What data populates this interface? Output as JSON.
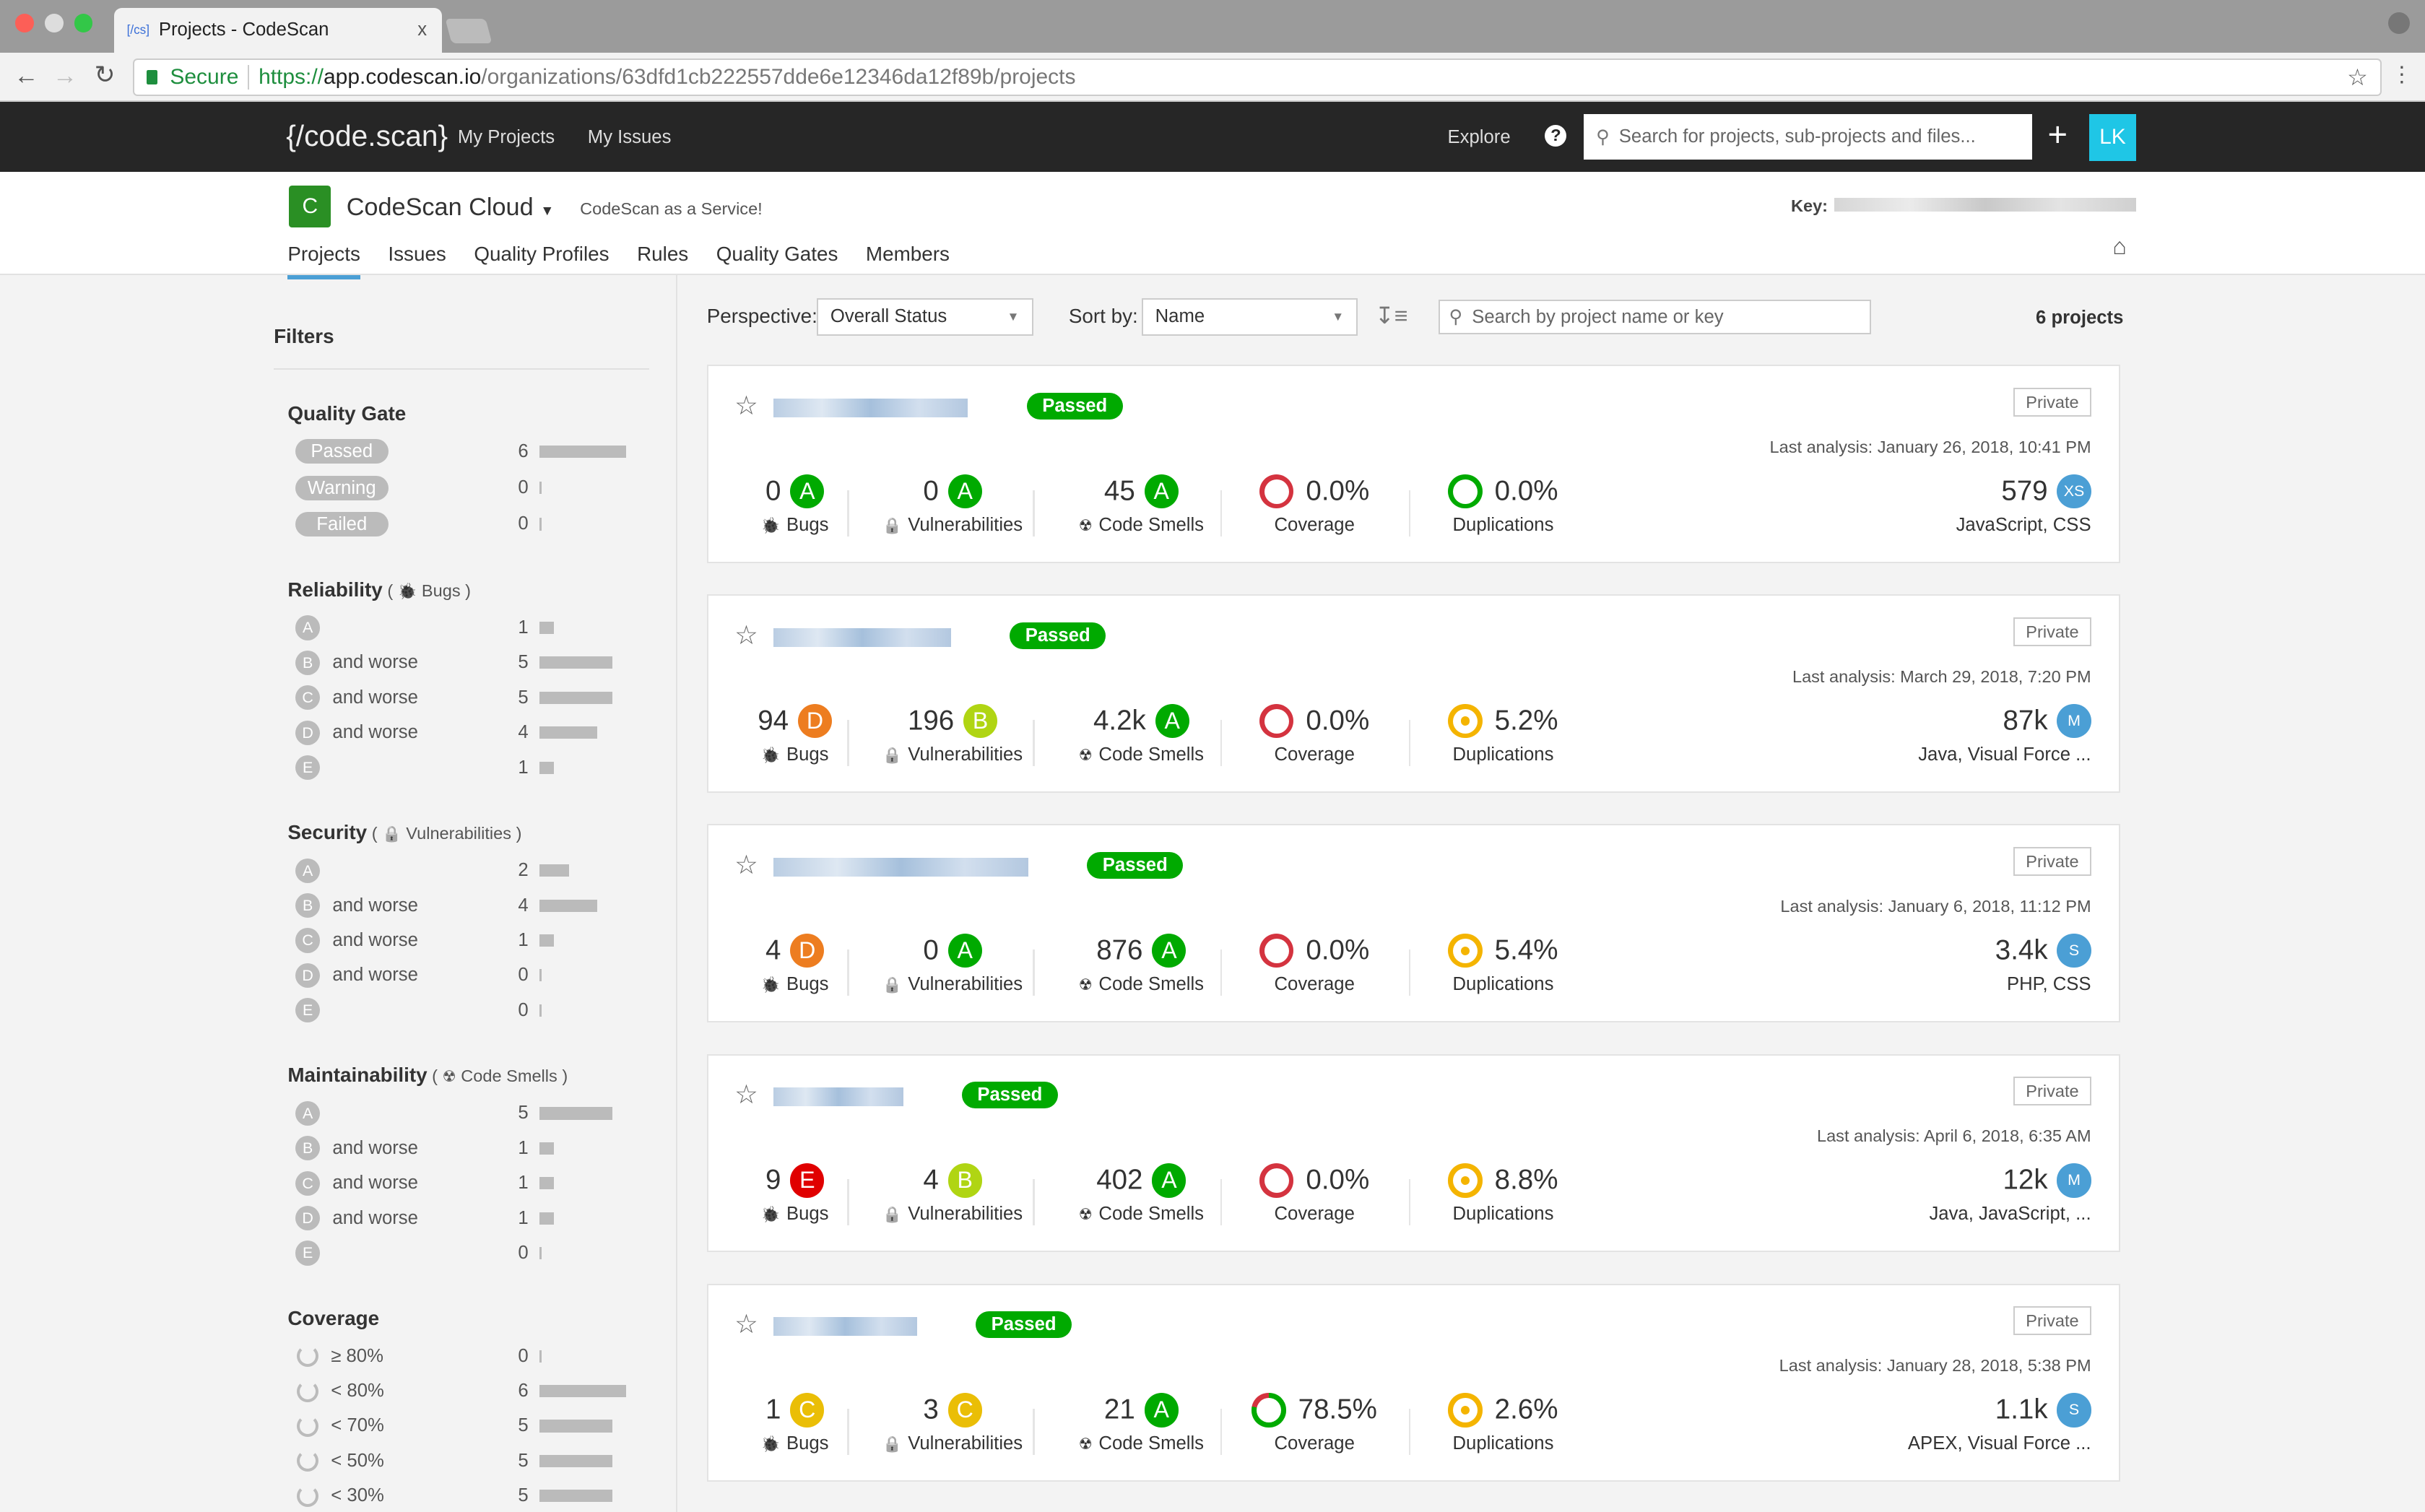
{
  "browser": {
    "tab_favicon": "[/cs]",
    "tab_title": "Projects - CodeScan",
    "tab_close": "x",
    "secure": "Secure",
    "url_proto": "https://",
    "url_host": "app.codescan.io",
    "url_path": "/organizations/63dfd1cb222557dde6e12346da12f89b/projects"
  },
  "nav": {
    "logo": "{/code.scan}",
    "my_projects": "My Projects",
    "my_issues": "My Issues",
    "explore": "Explore",
    "help": "?",
    "search_placeholder": "Search for projects, sub-projects and files...",
    "plus": "+",
    "avatar": "LK"
  },
  "org": {
    "icon_letter": "C",
    "name": "CodeScan Cloud",
    "tagline": "CodeScan as a Service!",
    "key_label": "Key:",
    "menu": [
      "Projects",
      "Issues",
      "Quality Profiles",
      "Rules",
      "Quality Gates",
      "Members"
    ]
  },
  "toolbar": {
    "perspective_label": "Perspective:",
    "perspective_value": "Overall Status",
    "sort_label": "Sort by:",
    "sort_value": "Name",
    "search_placeholder": "Search by project name or key",
    "count": "6 projects"
  },
  "filters": {
    "title": "Filters",
    "quality_gate": {
      "title": "Quality Gate",
      "rows": [
        {
          "label": "Passed",
          "count": 6
        },
        {
          "label": "Warning",
          "count": 0
        },
        {
          "label": "Failed",
          "count": 0
        }
      ]
    },
    "reliability": {
      "title": "Reliability",
      "sub": "Bugs",
      "rows": [
        {
          "r": "A",
          "label": "",
          "count": 1
        },
        {
          "r": "B",
          "label": "and worse",
          "count": 5
        },
        {
          "r": "C",
          "label": "and worse",
          "count": 5
        },
        {
          "r": "D",
          "label": "and worse",
          "count": 4
        },
        {
          "r": "E",
          "label": "",
          "count": 1
        }
      ]
    },
    "security": {
      "title": "Security",
      "sub": "Vulnerabilities",
      "rows": [
        {
          "r": "A",
          "label": "",
          "count": 2
        },
        {
          "r": "B",
          "label": "and worse",
          "count": 4
        },
        {
          "r": "C",
          "label": "and worse",
          "count": 1
        },
        {
          "r": "D",
          "label": "and worse",
          "count": 0
        },
        {
          "r": "E",
          "label": "",
          "count": 0
        }
      ]
    },
    "maintainability": {
      "title": "Maintainability",
      "sub": "Code Smells",
      "rows": [
        {
          "r": "A",
          "label": "",
          "count": 5
        },
        {
          "r": "B",
          "label": "and worse",
          "count": 1
        },
        {
          "r": "C",
          "label": "and worse",
          "count": 1
        },
        {
          "r": "D",
          "label": "and worse",
          "count": 1
        },
        {
          "r": "E",
          "label": "",
          "count": 0
        }
      ]
    },
    "coverage": {
      "title": "Coverage",
      "rows": [
        {
          "label": "≥ 80%",
          "count": 0
        },
        {
          "label": "< 80%",
          "count": 6
        },
        {
          "label": "< 70%",
          "count": 5
        },
        {
          "label": "< 50%",
          "count": 5
        },
        {
          "label": "< 30%",
          "count": 5
        }
      ]
    }
  },
  "rating_colors": {
    "A": "#00aa00",
    "B": "#b0d513",
    "C": "#eabe06",
    "D": "#ed7d20",
    "E": "#e00000"
  },
  "labels": {
    "bugs": "Bugs",
    "vulns": "Vulnerabilities",
    "smells": "Code Smells",
    "coverage": "Coverage",
    "dup": "Duplications",
    "private": "Private"
  },
  "projects": [
    {
      "gate": "Passed",
      "last": "Last analysis: January 26, 2018, 10:41 PM",
      "bugs": "0",
      "bugs_r": "A",
      "vulns": "0",
      "vulns_r": "A",
      "smells": "45",
      "smells_r": "A",
      "coverage": "0.0%",
      "dup": "0.0%",
      "lines": "579",
      "size": "XS",
      "langs": "JavaScript, CSS"
    },
    {
      "gate": "Passed",
      "last": "Last analysis: March 29, 2018, 7:20 PM",
      "bugs": "94",
      "bugs_r": "D",
      "vulns": "196",
      "vulns_r": "B",
      "smells": "4.2k",
      "smells_r": "A",
      "coverage": "0.0%",
      "dup": "5.2%",
      "lines": "87k",
      "size": "M",
      "langs": "Java, Visual Force ..."
    },
    {
      "gate": "Passed",
      "last": "Last analysis: January 6, 2018, 11:12 PM",
      "bugs": "4",
      "bugs_r": "D",
      "vulns": "0",
      "vulns_r": "A",
      "smells": "876",
      "smells_r": "A",
      "coverage": "0.0%",
      "dup": "5.4%",
      "lines": "3.4k",
      "size": "S",
      "langs": "PHP, CSS"
    },
    {
      "gate": "Passed",
      "last": "Last analysis: April 6, 2018, 6:35 AM",
      "bugs": "9",
      "bugs_r": "E",
      "vulns": "4",
      "vulns_r": "B",
      "smells": "402",
      "smells_r": "A",
      "coverage": "0.0%",
      "dup": "8.8%",
      "lines": "12k",
      "size": "M",
      "langs": "Java, JavaScript, ..."
    },
    {
      "gate": "Passed",
      "last": "Last analysis: January 28, 2018, 5:38 PM",
      "bugs": "1",
      "bugs_r": "C",
      "vulns": "3",
      "vulns_r": "C",
      "smells": "21",
      "smells_r": "A",
      "coverage": "78.5%",
      "dup": "2.6%",
      "lines": "1.1k",
      "size": "S",
      "langs": "APEX, Visual Force ..."
    }
  ]
}
